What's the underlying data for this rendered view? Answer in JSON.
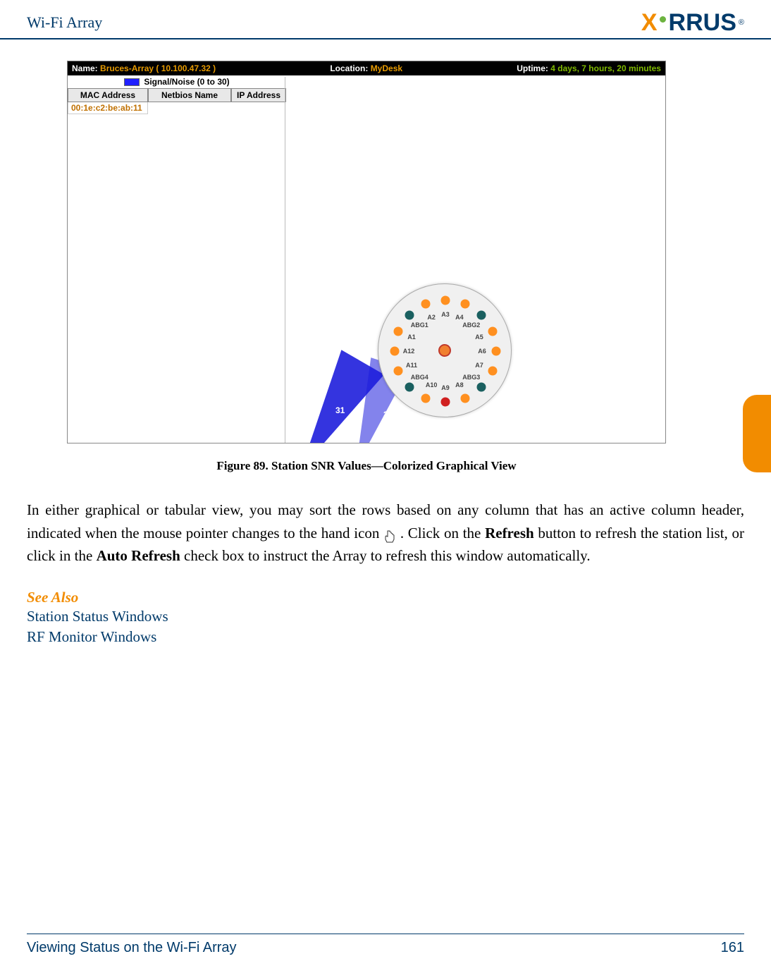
{
  "header": {
    "title": "Wi-Fi Array",
    "logo_x": "X",
    "logo_rest": "RRUS",
    "logo_reg": "®"
  },
  "app": {
    "name_label": "Name:",
    "name_value": "Bruces-Array",
    "name_ip": "( 10.100.47.32 )",
    "location_label": "Location:",
    "location_value": "MyDesk",
    "uptime_label": "Uptime:",
    "uptime_value": "4 days, 7 hours, 20 minutes",
    "legend": "Signal/Noise (0 to 30)",
    "columns": {
      "c1": "MAC Address",
      "c2": "Netbios Name",
      "c3": "IP Address"
    },
    "row1_mac": "00:1e:c2:be:ab:11",
    "beam1_val": "31",
    "beam2_val": "33",
    "aps": [
      {
        "label": "A12",
        "color": "orange",
        "angle": -90
      },
      {
        "label": "A1",
        "color": "orange",
        "angle": -67.5
      },
      {
        "label": "ABG1",
        "color": "teal",
        "angle": -45
      },
      {
        "label": "A2",
        "color": "orange",
        "angle": -22.5
      },
      {
        "label": "A3",
        "color": "orange",
        "angle": 0
      },
      {
        "label": "A4",
        "color": "orange",
        "angle": 22.5
      },
      {
        "label": "ABG2",
        "color": "teal",
        "angle": 45
      },
      {
        "label": "A5",
        "color": "orange",
        "angle": 67.5
      },
      {
        "label": "A6",
        "color": "orange",
        "angle": 90
      },
      {
        "label": "A7",
        "color": "orange",
        "angle": 112.5
      },
      {
        "label": "ABG3",
        "color": "teal",
        "angle": 135
      },
      {
        "label": "A8",
        "color": "orange",
        "angle": 157.5
      },
      {
        "label": "A9",
        "color": "red",
        "angle": 180
      },
      {
        "label": "A10",
        "color": "orange",
        "angle": -157.5
      },
      {
        "label": "ABG4",
        "color": "teal",
        "angle": -135
      },
      {
        "label": "A11",
        "color": "orange",
        "angle": -112.5
      }
    ]
  },
  "figure_caption": "Figure 89. Station SNR Values—Colorized Graphical View",
  "body": {
    "p1a": "In either graphical or tabular view, you may sort the rows based on any column that has an active column header, indicated when the mouse pointer changes to the hand icon ",
    "p1b": ". Click on the ",
    "refresh": "Refresh",
    "p1c": " button to refresh the station list, or click in the ",
    "auto_refresh": "Auto Refresh",
    "p1d": " check box to instruct the Array to refresh this window automatically."
  },
  "see_also": {
    "heading": "See Also",
    "link1": "Station Status Windows",
    "link2": "RF Monitor Windows"
  },
  "footer": {
    "section": "Viewing Status on the Wi-Fi Array",
    "page": "161"
  }
}
